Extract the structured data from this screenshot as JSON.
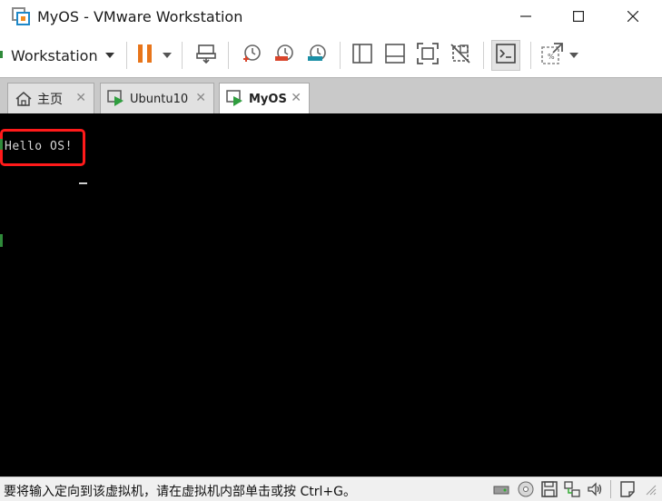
{
  "window": {
    "title": "MyOS - VMware Workstation",
    "app_icon": "vmware-icon",
    "controls": [
      "minimize-icon",
      "maximize-icon",
      "close-icon"
    ]
  },
  "toolbar": {
    "menu_label": "Workstation",
    "buttons": [
      {
        "name": "pause-vm-button",
        "icon": "pause-icon",
        "color": "#e8751a"
      },
      {
        "name": "send-ctrl-alt-del-button",
        "icon": "network-keyboard-icon"
      },
      {
        "name": "snapshot-take-button",
        "icon": "clock-snapshot-icon"
      },
      {
        "name": "snapshot-revert-button",
        "icon": "snapshot-revert-icon"
      },
      {
        "name": "snapshot-manager-button",
        "icon": "snapshot-manager-icon"
      },
      {
        "name": "show-library-button",
        "icon": "sidebar-panel-icon"
      },
      {
        "name": "show-thumbnail-bar-button",
        "icon": "bottom-panel-icon"
      },
      {
        "name": "full-screen-button",
        "icon": "fullscreen-icon"
      },
      {
        "name": "unity-button",
        "icon": "unity-icon"
      },
      {
        "name": "console-view-button",
        "icon": "terminal-icon"
      },
      {
        "name": "stretch-guest-button",
        "icon": "stretch-icon"
      }
    ]
  },
  "tabs": [
    {
      "label": "主页",
      "icon": "home-icon",
      "active": false
    },
    {
      "label": "Ubuntu10",
      "icon": "vm-play-icon",
      "active": false
    },
    {
      "label": "MyOS",
      "icon": "vm-play-icon",
      "active": true
    }
  ],
  "console": {
    "output_line": "Hello OS!",
    "background": "#000000",
    "highlight_color": "#ff1a1a"
  },
  "statusbar": {
    "message": "要将输入定向到该虚拟机，请在虚拟机内部单击或按 Ctrl+G。",
    "device_icons": [
      "hard-disk-icon",
      "cd-dvd-icon",
      "floppy-icon",
      "network-adapter-icon",
      "sound-card-icon",
      "message-log-icon"
    ]
  },
  "colors": {
    "accent_orange": "#e8751a",
    "vm_green": "#2f8a3a",
    "snapshot_red": "#d9452b",
    "snapshot_teal": "#1b8fa6"
  }
}
